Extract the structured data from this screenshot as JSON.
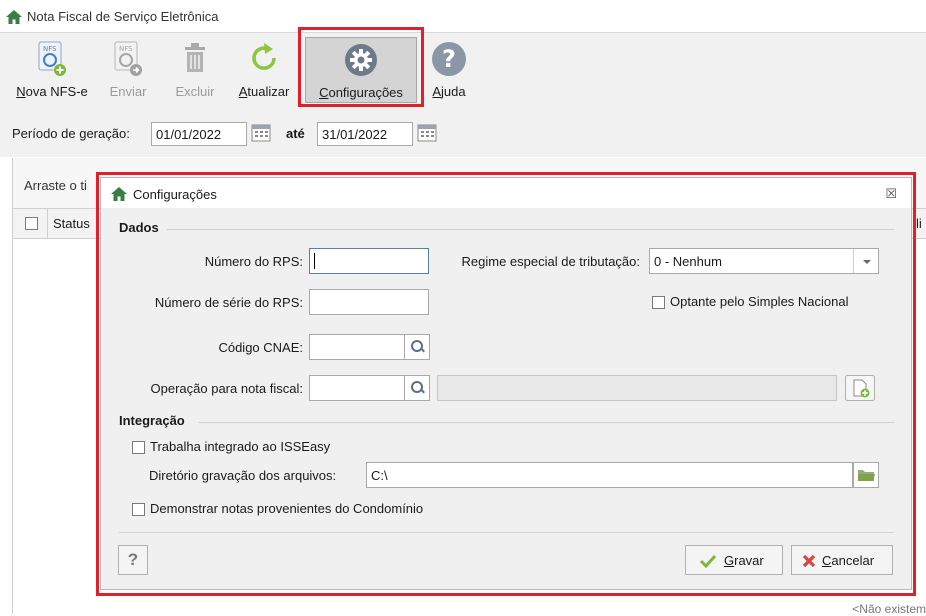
{
  "window": {
    "title": "Nota Fiscal de Serviço Eletrônica"
  },
  "toolbar": {
    "nova": "Nova NFS-e",
    "enviar": "Enviar",
    "excluir": "Excluir",
    "atualizar": "Atualizar",
    "configuracoes": "Configurações",
    "ajuda": "Ajuda",
    "nfs_badge": "NFS"
  },
  "period": {
    "label": "Período de geração:",
    "start": "01/01/2022",
    "sep": "até",
    "end": "31/01/2022"
  },
  "grid": {
    "group_hint": "Arraste o ti",
    "col_status": "Status",
    "col_right_partial": "li",
    "footer_partial": "<Não existem"
  },
  "dialog": {
    "title": "Configurações",
    "close": "☒",
    "dados": {
      "section": "Dados",
      "rps_label": "Número do RPS:",
      "rps_value": "",
      "serie_label": "Número de série do RPS:",
      "serie_value": "",
      "cnae_label": "Código CNAE:",
      "cnae_value": "",
      "operacao_label": "Operação para nota fiscal:",
      "operacao_value": "",
      "regime_label": "Regime especial de tributação:",
      "regime_value": "0 - Nenhum",
      "simples_label": "Optante pelo Simples Nacional"
    },
    "integracao": {
      "section": "Integração",
      "isseasy_label": "Trabalha integrado ao ISSEasy",
      "diretorio_label": "Diretório gravação dos arquivos:",
      "diretorio_value": "C:\\",
      "condominio_label": "Demonstrar notas provenientes do Condomínio"
    },
    "help": "?",
    "gravar": "Gravar",
    "cancelar": "Cancelar"
  },
  "colors": {
    "highlight": "#e0202b",
    "home": "#3a7d44",
    "check": "#7cb83a",
    "cancel": "#d9453a"
  }
}
